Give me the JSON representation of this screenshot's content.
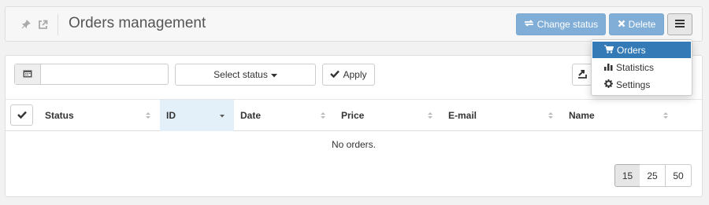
{
  "header": {
    "title": "Orders management",
    "change_status_label": "Change status",
    "delete_label": "Delete"
  },
  "menu": {
    "items": [
      {
        "label": "Orders",
        "icon": "cart-icon",
        "active": true
      },
      {
        "label": "Statistics",
        "icon": "bar-chart-icon",
        "active": false
      },
      {
        "label": "Settings",
        "icon": "gear-icon",
        "active": false
      }
    ]
  },
  "filters": {
    "date_value": "",
    "status_placeholder": "Select status",
    "apply_label": "Apply"
  },
  "table": {
    "columns": [
      "Status",
      "ID",
      "Date",
      "Price",
      "E-mail",
      "Name"
    ],
    "sorted_column": "ID",
    "empty_message": "No orders."
  },
  "pagination": {
    "page_sizes": [
      "15",
      "25",
      "50"
    ],
    "selected": "15"
  },
  "colors": {
    "primary_button": "#81aed6",
    "active_menu": "#337ab7",
    "sorted_header": "#e3f0f9"
  }
}
